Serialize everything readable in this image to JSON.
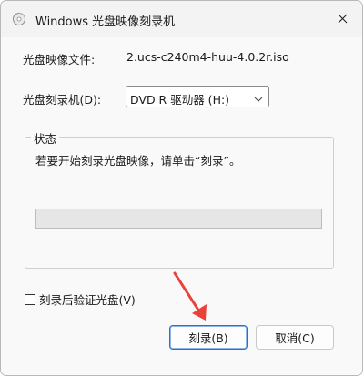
{
  "window": {
    "title": "Windows 光盘映像刻录机",
    "close_icon": "close-icon",
    "app_icon": "disc-burner-icon"
  },
  "image_file": {
    "label": "光盘映像文件:",
    "value": "2.ucs-c240m4-huu-4.0.2r.iso"
  },
  "burner": {
    "label": "光盘刻录机(D):",
    "selected": "DVD R 驱动器 (H:)"
  },
  "status": {
    "legend": "状态",
    "message": "若要开始刻录光盘映像，请单击“刻录”。",
    "progress": 0
  },
  "verify": {
    "label": "刻录后验证光盘(V)",
    "checked": false
  },
  "buttons": {
    "burn": "刻录(B)",
    "cancel": "取消(C)"
  },
  "colors": {
    "annotation_arrow": "#e8423a",
    "focus_border": "#2a6fc9"
  }
}
